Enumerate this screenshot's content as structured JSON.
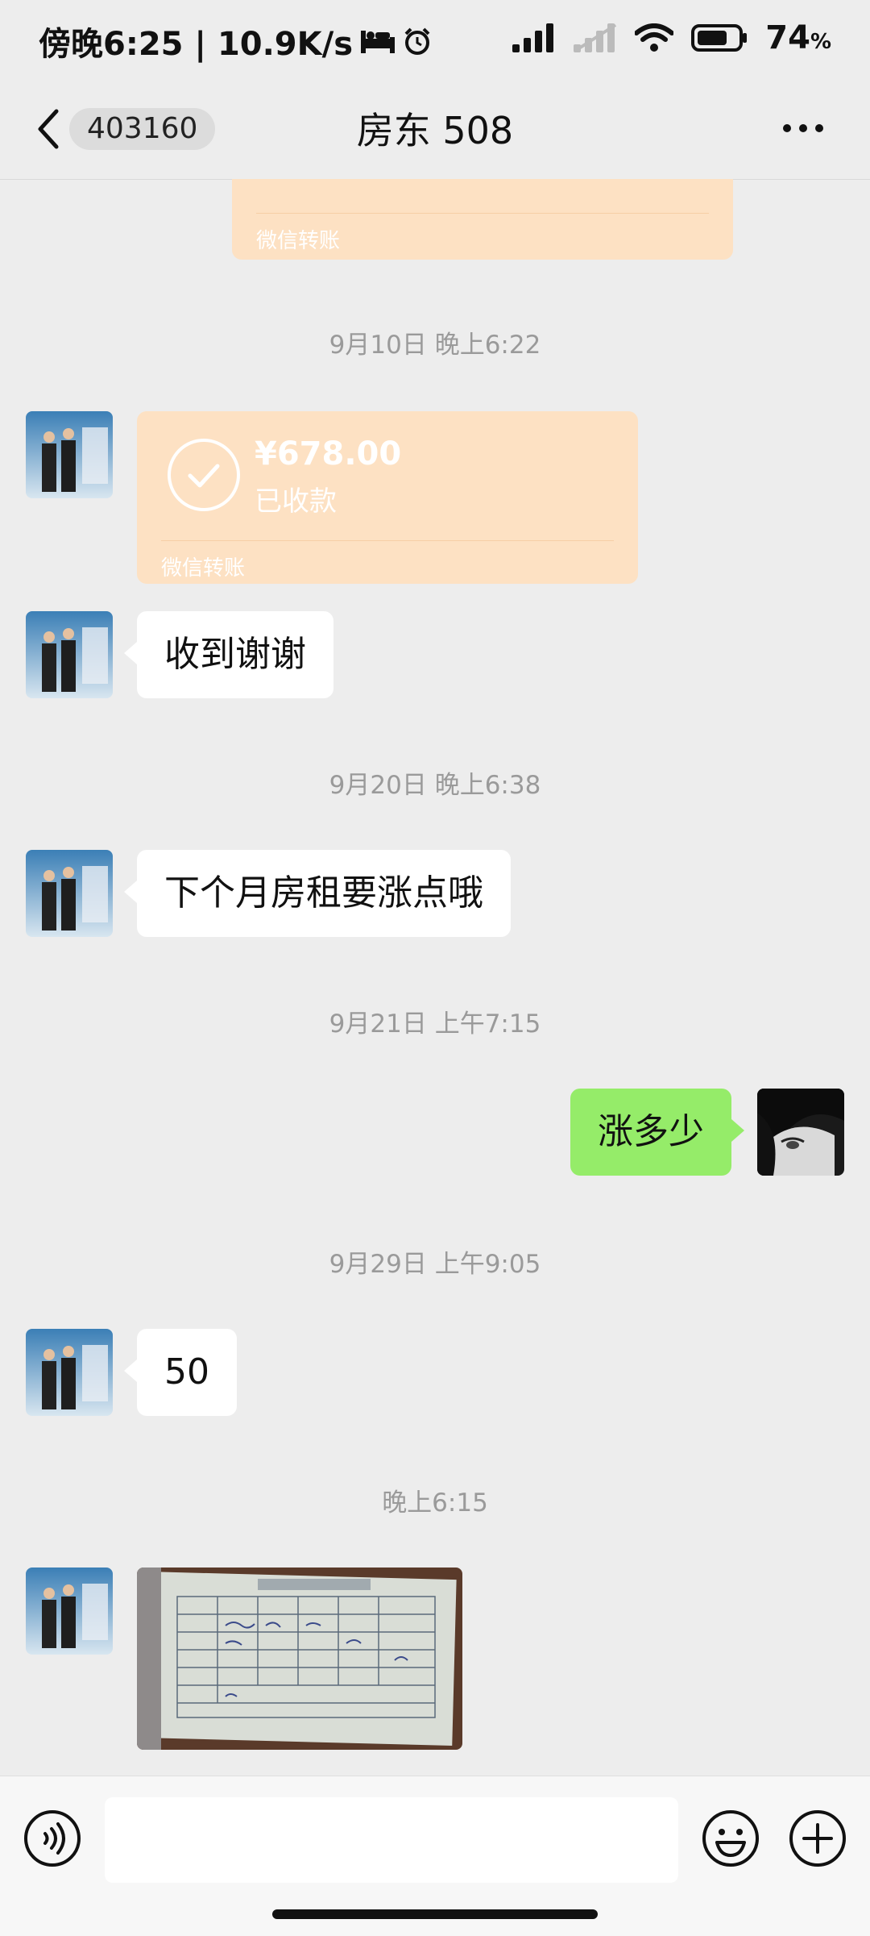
{
  "status_bar": {
    "time": "傍晚6:25 | 10.9K/s",
    "battery_percent": "74",
    "battery_unit": "%",
    "battery_level": 0.74
  },
  "nav": {
    "unread_count": "403160",
    "title": "房东 508"
  },
  "messages": {
    "top_transfer_label": "微信转账",
    "ts1": "9月10日 晚上6:22",
    "transfer_amount": "¥678.00",
    "transfer_status": "已收款",
    "transfer_label": "微信转账",
    "msg1": "收到谢谢",
    "ts2": "9月20日 晚上6:38",
    "msg2": "下个月房租要涨点哦",
    "ts3": "9月21日 上午7:15",
    "msg3": "涨多少",
    "ts4": "9月29日 上午9:05",
    "msg4": "50",
    "ts5": "晚上6:15"
  },
  "colors": {
    "background": "#ededed",
    "bubble_self": "#95ec69",
    "bubble_other": "#ffffff",
    "transfer": "#fde1c3",
    "timestamp": "#9a9a9a"
  },
  "icons": [
    "back-icon",
    "more-icon",
    "check-icon",
    "voice-icon",
    "emoji-icon",
    "plus-icon",
    "signal-icon",
    "wifi-icon",
    "battery-icon",
    "alarm-icon",
    "bed-icon"
  ]
}
